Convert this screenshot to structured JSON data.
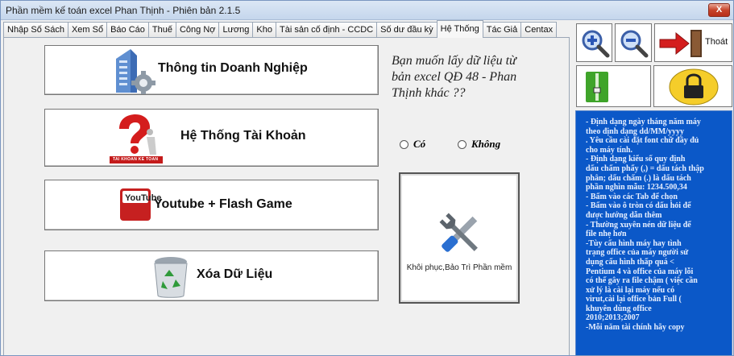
{
  "window": {
    "title": "Phần mềm kế toán excel Phan Thịnh  - Phiên bản 2.1.5",
    "close_label": "X"
  },
  "tabs": [
    "Nhập Số Sách",
    "Xem Sổ",
    "Báo Cáo",
    "Thuế",
    "Công Nợ",
    "Lương",
    "Kho",
    "Tài sản cố định - CCDC",
    "Số dư đầu kỳ",
    "Hệ Thống",
    "Tác Giả",
    "Centax"
  ],
  "active_tab": "Hệ Thống",
  "buttons": {
    "company_info": "Thông tin Doanh Nghiệp",
    "account_system": "Hệ Thống Tài Khoản",
    "account_system_logo": "TAI KHOAN KE TOAN",
    "youtube": "Youtube + Flash Game",
    "youtube_logo": "YouTube",
    "delete_data": "Xóa Dữ Liệu",
    "repair": "Khôi phục,Bảo Trì Phần mềm",
    "exit": "Thoát"
  },
  "question": "Bạn muốn lấy dữ liệu từ bản excel QĐ 48 - Phan Thịnh khác ??",
  "radio": {
    "yes": "Có",
    "no": "Không"
  },
  "info_lines": [
    "- Định dạng ngày tháng năm máy",
    "theo định dạng        dd/MM/yyyy",
    ". Yêu cầu cài đặt font chữ đầy đủ",
    "cho máy tính.",
    "- Định dạng kiểu số  quy định",
    "dấu chấm phẩy (,) = dấu tách thập",
    "phân; dấu chấm (.) là dấu tách",
    "phần nghìn mẫu: 1234.500,34",
    "- Bấm vào các Tab để chọn",
    "- Bấm vào ô tròn có dấu hỏi để",
    "được hướng dẫn thêm",
    "- Thường xuyên nén dữ liệu để",
    "file nhẹ hơn",
    " -Tùy cấu hình máy hay tình",
    "trạng office của máy người sử",
    "dụng cấu hình thấp quá <",
    "Pentium 4 và office của máy lỗi",
    "có thể gây ra  file chậm ( việc cần",
    "xử lý là cài lại máy nếu có",
    "virut,cài lại office bản Full (",
    "khuyên dùng office",
    "2010;2013;2007",
    " -Mỗi năm tài chính hãy copy"
  ]
}
